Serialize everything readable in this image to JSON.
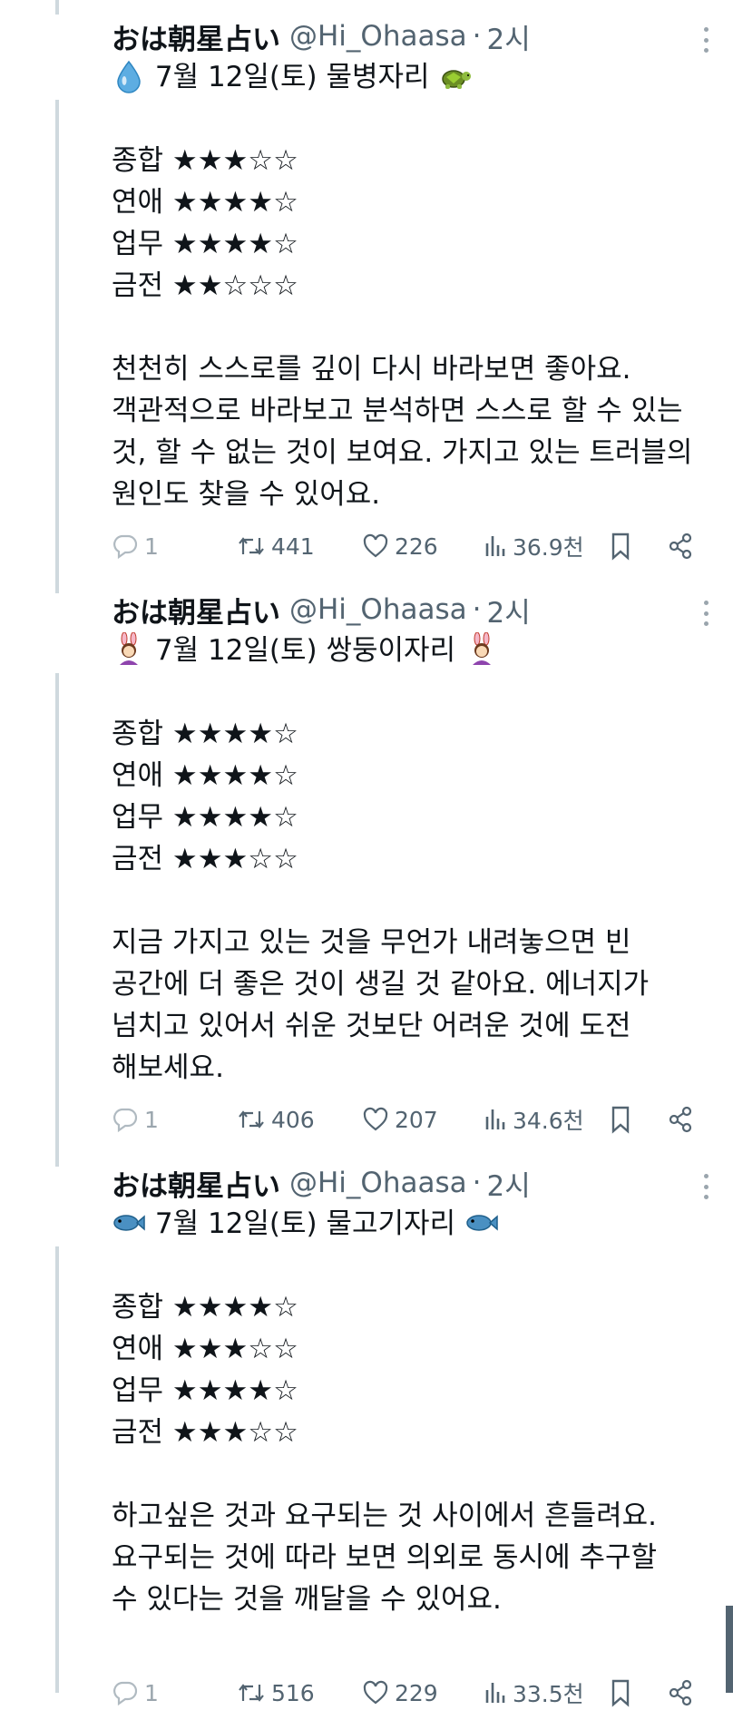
{
  "tweets": [
    {
      "name": "おは朝星占い",
      "handle": "@Hi_Ohaasa",
      "separator": "·",
      "time": "2시",
      "header_line": "7월 12일(토) 물병자리",
      "lead_icon": "droplet-icon",
      "trail_icon": "turtle-icon",
      "ratings": [
        {
          "label": "종합",
          "stars": "★★★☆☆"
        },
        {
          "label": "연애",
          "stars": "★★★★☆"
        },
        {
          "label": "업무",
          "stars": "★★★★☆"
        },
        {
          "label": "금전",
          "stars": "★★☆☆☆"
        }
      ],
      "text_lines": [
        "천천히 스스로를 깊이 다시 바라보면 좋아요.",
        "객관적으로 바라보고 분석하면 스스로 할 수 있는",
        "것, 할 수 없는 것이 보여요. 가지고 있는 트러블의",
        "원인도 찾을 수 있어요."
      ],
      "stats": {
        "replies": "1",
        "retweets": "441",
        "likes": "226",
        "views": "36.9천"
      }
    },
    {
      "name": "おは朝星占い",
      "handle": "@Hi_Ohaasa",
      "separator": "·",
      "time": "2시",
      "header_line": "7월 12일(토) 쌍둥이자리",
      "lead_icon": "bunny-girls-icon",
      "trail_icon": "bunny-girls-icon",
      "ratings": [
        {
          "label": "종합",
          "stars": "★★★★☆"
        },
        {
          "label": "연애",
          "stars": "★★★★☆"
        },
        {
          "label": "업무",
          "stars": "★★★★☆"
        },
        {
          "label": "금전",
          "stars": "★★★☆☆"
        }
      ],
      "text_lines": [
        "지금 가지고 있는 것을 무언가 내려놓으면 빈",
        "공간에 더 좋은 것이 생길 것 같아요. 에너지가",
        "넘치고 있어서 쉬운 것보단 어려운 것에 도전",
        "해보세요."
      ],
      "stats": {
        "replies": "1",
        "retweets": "406",
        "likes": "207",
        "views": "34.6천"
      }
    },
    {
      "name": "おは朝星占い",
      "handle": "@Hi_Ohaasa",
      "separator": "·",
      "time": "2시",
      "header_line": "7월 12일(토) 물고기자리",
      "lead_icon": "fish-icon",
      "trail_icon": "fish-icon",
      "ratings": [
        {
          "label": "종합",
          "stars": "★★★★☆"
        },
        {
          "label": "연애",
          "stars": "★★★☆☆"
        },
        {
          "label": "업무",
          "stars": "★★★★☆"
        },
        {
          "label": "금전",
          "stars": "★★★☆☆"
        }
      ],
      "text_lines": [
        "하고싶은 것과 요구되는 것 사이에서 흔들려요.",
        "요구되는 것에 따라 보면 의외로 동시에 추구할",
        "수 있다는 것을 깨달을 수 있어요."
      ],
      "stats": {
        "replies": "1",
        "retweets": "516",
        "likes": "229",
        "views": "33.5천"
      }
    }
  ]
}
